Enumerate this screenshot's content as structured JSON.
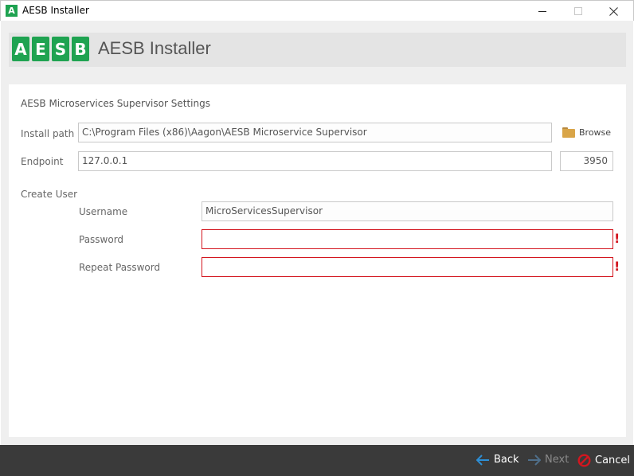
{
  "window": {
    "title": "AESB Installer",
    "icon_letter": "A",
    "controls": {
      "minimize": "minimize-icon",
      "maximize": "maximize-icon",
      "close": "close-icon"
    }
  },
  "header": {
    "logo_letters": [
      "A",
      "E",
      "S",
      "B"
    ],
    "title": "AESB Installer"
  },
  "form": {
    "section_title": "AESB Microservices Supervisor Settings",
    "install_path": {
      "label": "Install path",
      "value": "C:\\Program Files (x86)\\Aagon\\AESB Microservice Supervisor"
    },
    "browse_label": "Browse",
    "endpoint": {
      "label": "Endpoint",
      "value": "127.0.0.1",
      "port": "3950"
    },
    "create_user": {
      "label": "Create User",
      "username": {
        "label": "Username",
        "value": "MicroServicesSupervisor"
      },
      "password": {
        "label": "Password",
        "value": "",
        "error_marker": "!"
      },
      "repeat_password": {
        "label": "Repeat Password",
        "value": "",
        "error_marker": "!"
      }
    }
  },
  "footer": {
    "back_label": "Back",
    "next_label": "Next",
    "cancel_label": "Cancel"
  },
  "colors": {
    "brand_green": "#1fa351",
    "error_red": "#d3161f",
    "nav_arrow_blue": "#2d8fd6",
    "footer_bg": "#3a3a3a"
  }
}
